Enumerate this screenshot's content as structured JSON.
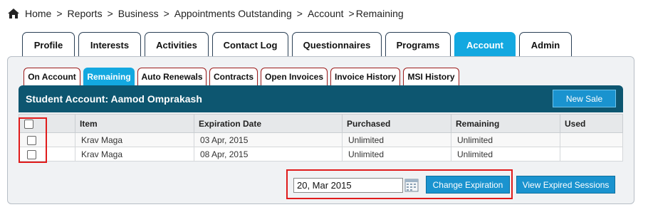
{
  "breadcrumb": {
    "items": [
      "Home",
      "Reports",
      "Business",
      "Appointments Outstanding",
      "Account",
      "Remaining"
    ],
    "separator": ">"
  },
  "top_tabs": [
    {
      "label": "Profile"
    },
    {
      "label": "Interests"
    },
    {
      "label": "Activities"
    },
    {
      "label": "Contact Log"
    },
    {
      "label": "Questionnaires"
    },
    {
      "label": "Programs"
    },
    {
      "label": "Account",
      "active": true
    },
    {
      "label": "Admin"
    }
  ],
  "sub_tabs": [
    {
      "label": "On Account"
    },
    {
      "label": "Remaining",
      "active": true
    },
    {
      "label": "Auto Renewals"
    },
    {
      "label": "Contracts"
    },
    {
      "label": "Open Invoices"
    },
    {
      "label": "Invoice History"
    },
    {
      "label": "MSI History"
    }
  ],
  "account": {
    "title": "Student Account: Aamod Omprakash",
    "new_sale_label": "New Sale"
  },
  "table": {
    "columns": [
      "Item",
      "Expiration Date",
      "Purchased",
      "Remaining",
      "Used"
    ],
    "rows": [
      {
        "item": "Krav Maga",
        "expiration": "03 Apr, 2015",
        "purchased": "Unlimited",
        "remaining": "Unlimited",
        "used": ""
      },
      {
        "item": "Krav Maga",
        "expiration": "08 Apr, 2015",
        "purchased": "Unlimited",
        "remaining": "Unlimited",
        "used": ""
      }
    ]
  },
  "controls": {
    "date_value": "20, Mar 2015",
    "change_expiration_label": "Change Expiration",
    "view_expired_label": "View Expired Sessions"
  },
  "colors": {
    "accent": "#13a8e0",
    "header_bar": "#0d5670",
    "button": "#1a93cf",
    "highlight": "#e01b1b"
  }
}
